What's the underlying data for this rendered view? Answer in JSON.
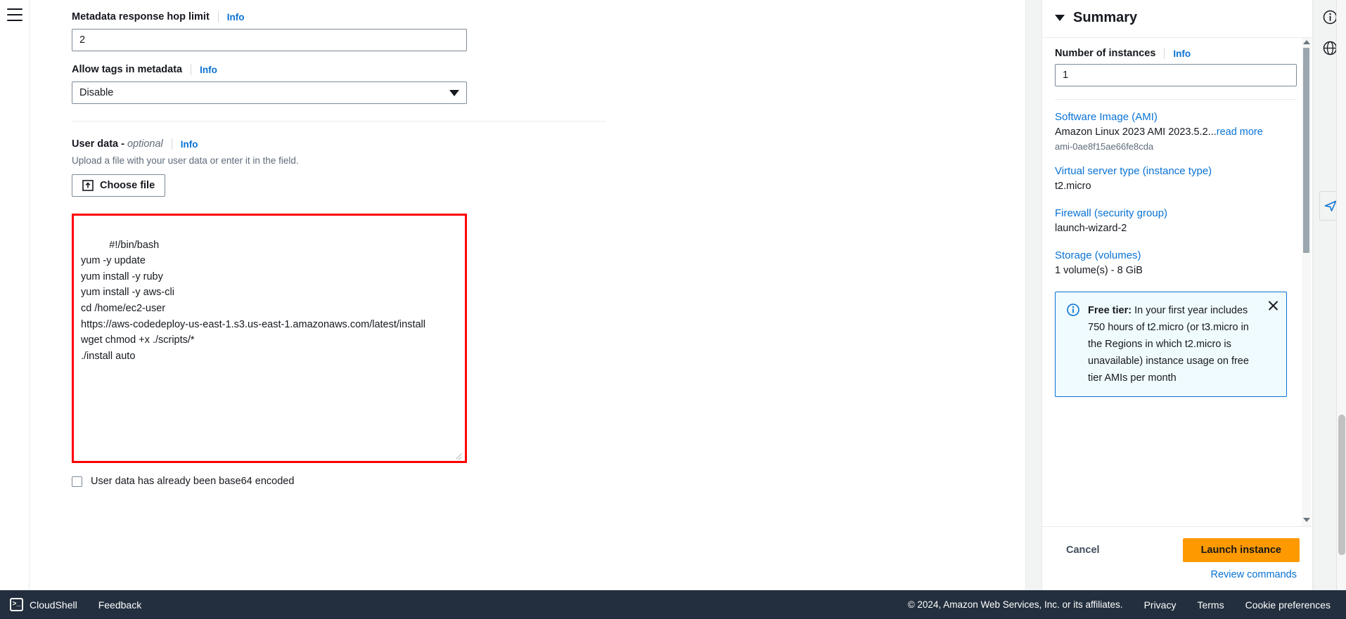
{
  "form": {
    "hop_limit": {
      "label": "Metadata response hop limit",
      "info": "Info",
      "value": "2"
    },
    "allow_tags": {
      "label": "Allow tags in metadata",
      "info": "Info",
      "value": "Disable"
    },
    "user_data": {
      "label": "User data -",
      "optional": "optional",
      "info": "Info",
      "description": "Upload a file with your user data or enter it in the field.",
      "choose_file_label": "Choose file",
      "choose_file_icon": "upload-icon",
      "script": "#!/bin/bash\nyum -y update\nyum install -y ruby\nyum install -y aws-cli\ncd /home/ec2-user\nhttps://aws-codedeploy-us-east-1.s3.us-east-1.amazonaws.com/latest/install\nwget chmod +x ./scripts/*\n./install auto",
      "base64_checkbox_label": "User data has already been base64 encoded",
      "base64_checked": false,
      "highlight_color": "#ff0000"
    }
  },
  "summary": {
    "title": "Summary",
    "collapse_icon": "caret-down-icon",
    "number_of_instances": {
      "label": "Number of instances",
      "info": "Info",
      "value": "1"
    },
    "items": [
      {
        "link": "Software Image (AMI)",
        "value": "Amazon Linux 2023 AMI 2023.5.2...",
        "read_more": "read more",
        "sub": "ami-0ae8f15ae66fe8cda"
      },
      {
        "link": "Virtual server type (instance type)",
        "value": "t2.micro",
        "read_more": "",
        "sub": ""
      },
      {
        "link": "Firewall (security group)",
        "value": "launch-wizard-2",
        "read_more": "",
        "sub": ""
      },
      {
        "link": "Storage (volumes)",
        "value": "1 volume(s) - 8 GiB",
        "read_more": "",
        "sub": ""
      }
    ],
    "alert": {
      "icon": "info-circle-icon",
      "strong": "Free tier:",
      "text": " In your first year includes 750 hours of t2.micro (or t3.micro in the Regions in which t2.micro is unavailable) instance usage on free tier AMIs per month",
      "close_icon": "close-icon"
    },
    "actions": {
      "cancel_label": "Cancel",
      "launch_label": "Launch instance",
      "review_label": "Review commands",
      "launch_color": "#ff9900"
    }
  },
  "rail": {
    "icons": [
      "info-circle-icon",
      "globe-icon",
      "feedback-paper-plane-icon"
    ]
  },
  "footer": {
    "cloudshell_label": "CloudShell",
    "cloudshell_icon": "terminal-icon",
    "feedback_label": "Feedback",
    "copyright": "© 2024, Amazon Web Services, Inc. or its affiliates.",
    "links": [
      "Privacy",
      "Terms",
      "Cookie preferences"
    ],
    "background": "#232f3e"
  }
}
